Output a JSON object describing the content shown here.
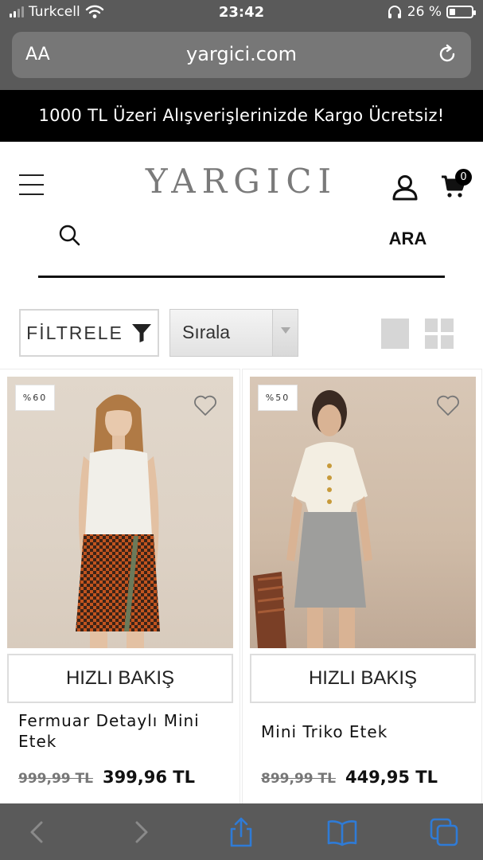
{
  "status_bar": {
    "carrier": "Turkcell",
    "time": "23:42",
    "battery_percent": "26 %",
    "battery_level": 0.26,
    "icons": [
      "signal-icon",
      "wifi-icon",
      "headphones-icon",
      "battery-icon"
    ]
  },
  "browser": {
    "text_size_label": "AA",
    "url": "yargici.com",
    "icons": [
      "reload-icon",
      "back-arrow-icon",
      "forward-arrow-icon",
      "share-icon",
      "bookmarks-icon",
      "tabs-icon"
    ]
  },
  "promo_banner": {
    "text": "1000 TL Üzeri Alışverişlerinizde Kargo Ücretsiz!"
  },
  "header": {
    "logo": "YARGICI",
    "cart_count": "0",
    "icons": [
      "hamburger-menu-icon",
      "user-icon",
      "cart-icon"
    ]
  },
  "search": {
    "placeholder": "",
    "value": "",
    "button_label": "ARA"
  },
  "toolbar": {
    "filter_label": "FİLTRELE",
    "sort_label": "Sırala",
    "icons": [
      "filter-funnel-icon",
      "single-column-grid-icon",
      "four-grid-icon"
    ]
  },
  "products": [
    {
      "discount": "%60",
      "quick_view_label": "HIZLI BAKIŞ",
      "name": "Fermuar Detaylı Mini Etek",
      "old_price": "999,99 TL",
      "new_price": "399,96 TL"
    },
    {
      "discount": "%50",
      "quick_view_label": "HIZLI BAKIŞ",
      "name": "Mini Triko Etek",
      "old_price": "899,99 TL",
      "new_price": "449,95 TL"
    }
  ],
  "colors": {
    "browser_chrome": "#5a5a5a",
    "promo_background": "#000000",
    "logo_gray": "#7a7a7a",
    "ios_blue": "#2f7bd6"
  }
}
